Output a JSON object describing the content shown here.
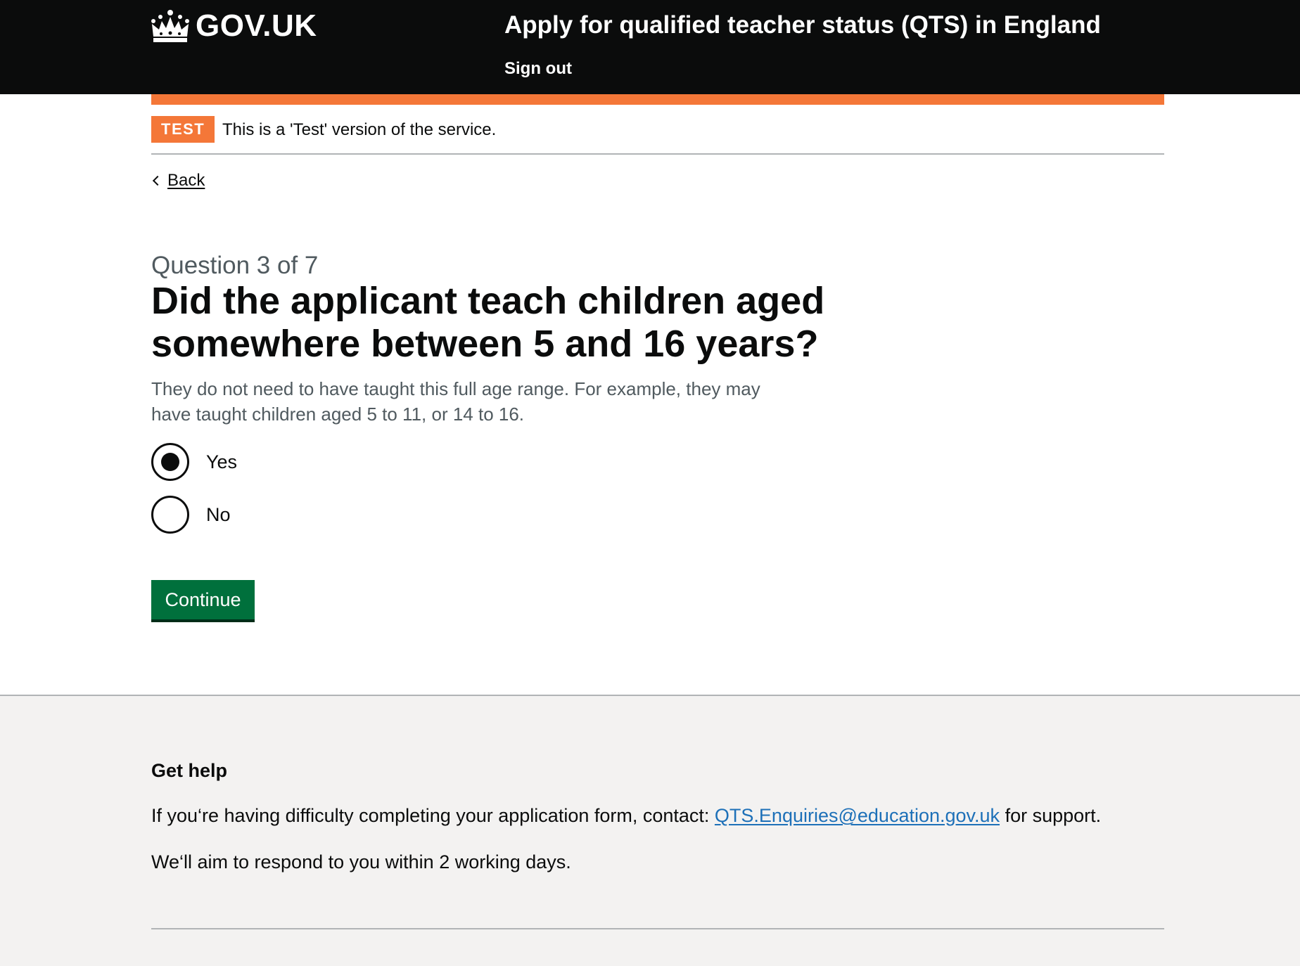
{
  "header": {
    "logo_text": "GOV.UK",
    "service_name": "Apply for qualified teacher status (QTS) in England",
    "sign_out_label": "Sign out"
  },
  "phase_banner": {
    "tag": "TEST",
    "text": "This is a 'Test' version of the service."
  },
  "back_link": "Back",
  "form": {
    "caption": "Question 3 of 7",
    "question": "Did the applicant teach children aged somewhere between 5 and 16 years?",
    "hint": "They do not need to have taught this full age range. For example, they may have taught children aged 5 to 11, or 14 to 16.",
    "options": [
      {
        "label": "Yes",
        "checked": true
      },
      {
        "label": "No",
        "checked": false
      }
    ],
    "continue_label": "Continue"
  },
  "footer": {
    "heading": "Get help",
    "help_prefix": "If you‘re having difficulty completing your application form, contact:",
    "email": "QTS.Enquiries@education.gov.uk",
    "help_suffix": "for support.",
    "response_text": "We‘ll aim to respond to you within 2 working days."
  },
  "colors": {
    "header_bg": "#0b0c0c",
    "phase_orange": "#f47738",
    "button_green": "#00703c",
    "link_blue": "#1d70b8",
    "footer_bg": "#f3f2f1",
    "secondary_text": "#505a5f"
  },
  "icons": {
    "logo": "crown-icon",
    "back": "chevron-left-icon"
  }
}
